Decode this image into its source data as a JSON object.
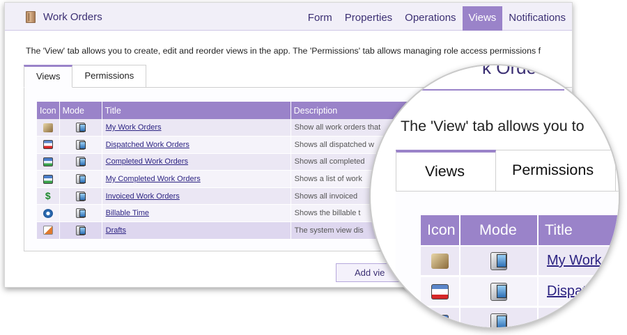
{
  "app": {
    "title": "Work Orders",
    "icon": "book-icon"
  },
  "nav": {
    "tabs": [
      {
        "label": "Form",
        "active": false
      },
      {
        "label": "Properties",
        "active": false
      },
      {
        "label": "Operations",
        "active": false
      },
      {
        "label": "Views",
        "active": true
      },
      {
        "label": "Notifications",
        "active": false
      }
    ]
  },
  "intro": "The 'View' tab allows you to create, edit and reorder views in the app. The 'Permissions' tab allows managing role access permissions f",
  "subtabs": {
    "views": "Views",
    "permissions": "Permissions"
  },
  "table": {
    "headers": {
      "icon": "Icon",
      "mode": "Mode",
      "title": "Title",
      "description": "Description"
    },
    "rows": [
      {
        "icon": "drill-icon",
        "mode": "tablet-mode-icon",
        "title": "My Work Orders",
        "description": "Show all work orders that"
      },
      {
        "icon": "dispatch-icon",
        "mode": "tablet-mode-icon",
        "title": "Dispatched Work Orders",
        "description": "Shows all dispatched w"
      },
      {
        "icon": "completed-icon",
        "mode": "tablet-mode-icon",
        "title": "Completed Work Orders",
        "description": "Shows all completed"
      },
      {
        "icon": "completed-icon",
        "mode": "tablet-mode-icon",
        "title": "My Completed Work Orders",
        "description": "Shows a list of work"
      },
      {
        "icon": "dollar-icon",
        "mode": "tablet-mode-icon",
        "title": "Invoiced Work Orders",
        "description": "Shows all invoiced"
      },
      {
        "icon": "clock-icon",
        "mode": "tablet-mode-icon",
        "title": "Billable Time",
        "description": "Shows the billable t"
      },
      {
        "icon": "draft-icon",
        "mode": "tablet-mode-icon",
        "title": "Drafts",
        "description": "The system view dis"
      }
    ]
  },
  "add_button": "Add vie",
  "magnifier": {
    "behind_text": "k Orde",
    "intro": "The 'View' tab allows you to",
    "tabs": {
      "views": "Views",
      "permissions": "Permissions"
    },
    "headers": {
      "icon": "Icon",
      "mode": "Mode",
      "title": "Title"
    },
    "rows": [
      {
        "icon": "drill-icon",
        "title": "My Work O"
      },
      {
        "icon": "dispatch-icon",
        "title": "Dispat"
      },
      {
        "icon": "completed-icon",
        "title": ""
      }
    ]
  },
  "colors": {
    "accent": "#9a83c9",
    "link": "#2c2382",
    "nav_text": "#3b2f73"
  }
}
